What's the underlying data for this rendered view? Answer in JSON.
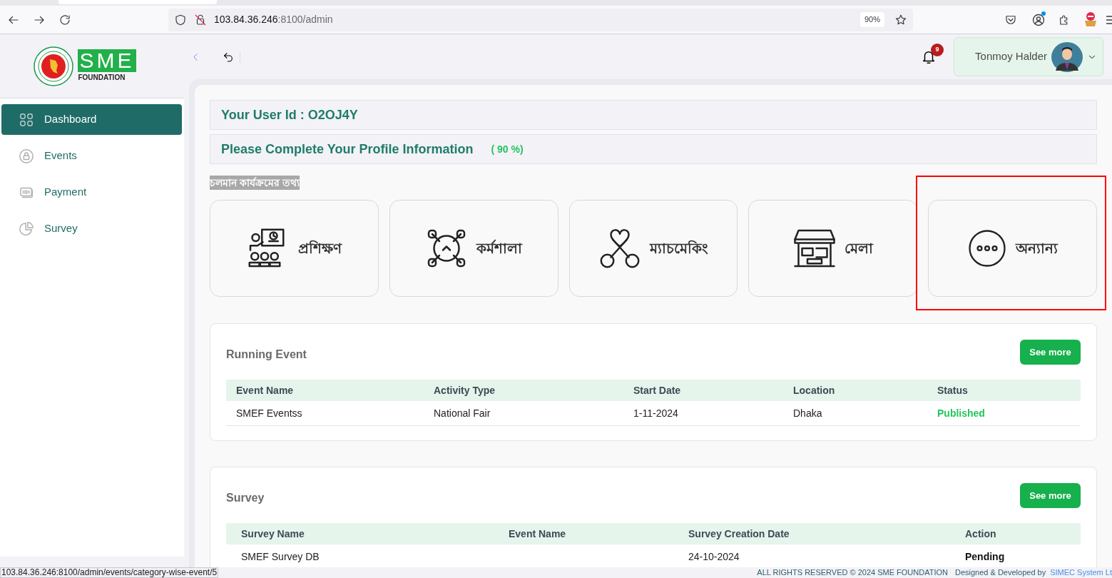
{
  "browser": {
    "url_host": "103.84.36.246",
    "url_path": ":8100/admin",
    "zoom": "90%"
  },
  "logo": {
    "wordmark": "SME",
    "subtitle": "FOUNDATION"
  },
  "sidebar": {
    "items": [
      {
        "label": "Dashboard",
        "kind": "grid",
        "selected": true
      },
      {
        "label": "Events",
        "kind": "lock",
        "selected": false
      },
      {
        "label": "Payment",
        "kind": "money",
        "selected": false
      },
      {
        "label": "Survey",
        "kind": "pie",
        "selected": false
      }
    ]
  },
  "header": {
    "notifications": "9",
    "user_name": "Tonmoy Halder"
  },
  "user_id": "Your User Id : O2OJ4Y",
  "profile": {
    "prompt": "Please Complete Your Profile Information",
    "percent": "( 90 %)"
  },
  "section_label": "চলমান কার্যক্রমের তথ্য",
  "categories": [
    {
      "label": "প্রশিক্ষণ",
      "kind": "training",
      "highlighted": false
    },
    {
      "label": "কর্মশালা",
      "kind": "workshop",
      "highlighted": false
    },
    {
      "label": "ম্যাচমেকিং",
      "kind": "matchmaking",
      "highlighted": false
    },
    {
      "label": "মেলা",
      "kind": "fair",
      "highlighted": false
    },
    {
      "label": "অন্যান্য",
      "kind": "other",
      "highlighted": true
    }
  ],
  "running_event": {
    "title": "Running Event",
    "button": "See more",
    "columns": [
      "Event Name",
      "Activity Type",
      "Start Date",
      "Location",
      "Status"
    ],
    "rows": [
      {
        "cells": [
          "SMEF Eventss",
          "National Fair",
          "1-11-2024",
          "Dhaka",
          "Published"
        ],
        "color": "#22c55e"
      }
    ]
  },
  "survey": {
    "title": "Survey",
    "button": "See more",
    "columns": [
      "Survey Name",
      "Event Name",
      "Survey Creation Date",
      "Action"
    ],
    "rows": [
      {
        "cells": [
          "SMEF Survey DB",
          "",
          "24-10-2024",
          "Pending"
        ]
      }
    ]
  },
  "status_url": "103.84.36.246:8100/admin/events/category-wise-event/5",
  "footer": {
    "rights": "ALL RIGHTS RESERVED © 2024 SME FOUNDATION",
    "designed": "Designed & Developed by",
    "company": "SIMEC System Lt"
  }
}
